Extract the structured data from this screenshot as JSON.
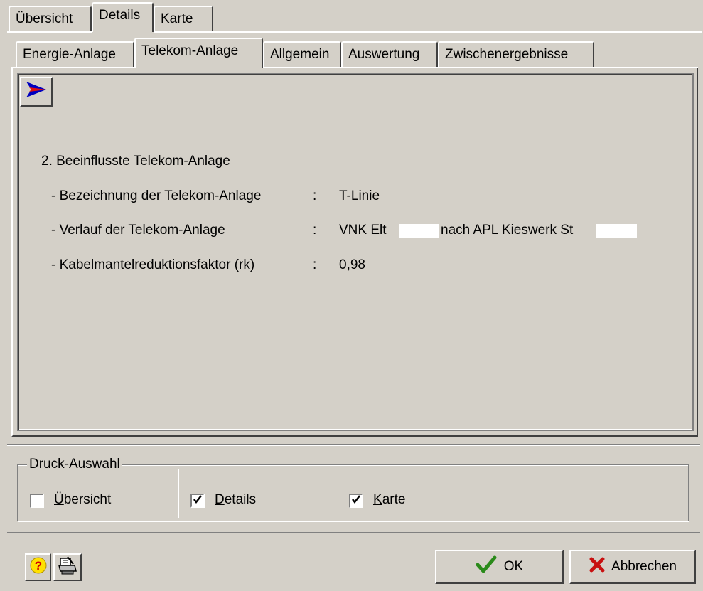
{
  "outer_tabs": [
    "Übersicht",
    "Details",
    "Karte"
  ],
  "inner_tabs": [
    "Energie-Anlage",
    "Telekom-Anlage",
    "Allgemein",
    "Auswertung",
    "Zwischenergebnisse"
  ],
  "content": {
    "heading": "2. Beeinflusste Telekom-Anlage",
    "rows": [
      {
        "label": "- Bezeichnung der Telekom-Anlage",
        "sep": ":",
        "value": "T-Linie",
        "value_suffix": ""
      },
      {
        "label": "- Verlauf der Telekom-Anlage",
        "sep": ":",
        "value": "VNK Elt",
        "value_mid": "nach APL Kieswerk St"
      },
      {
        "label": "- Kabelmantelreduktionsfaktor (rk)",
        "sep": ":",
        "value": "0,98",
        "value_suffix": ""
      }
    ]
  },
  "print_selection": {
    "title": "Druck-Auswahl",
    "options": [
      {
        "label_first": "Ü",
        "label_rest": "bersicht",
        "checked": false
      },
      {
        "label_first": "D",
        "label_rest": "etails",
        "checked": true
      },
      {
        "label_first": "K",
        "label_rest": "arte",
        "checked": true
      }
    ]
  },
  "buttons": {
    "ok_label": "OK",
    "cancel_label": "Abbrechen"
  },
  "icons": {
    "arrow": "arrow-right-icon",
    "help": "help-icon",
    "print_setup": "print-setup-icon",
    "check": "checkmark-icon",
    "cross": "cross-icon"
  },
  "colors": {
    "window_bg": "#d4d0c8",
    "ok_check": "#2a8a1a",
    "cancel_cross": "#c81010",
    "arrow_blue": "#0000c0",
    "arrow_red": "#e01010"
  }
}
